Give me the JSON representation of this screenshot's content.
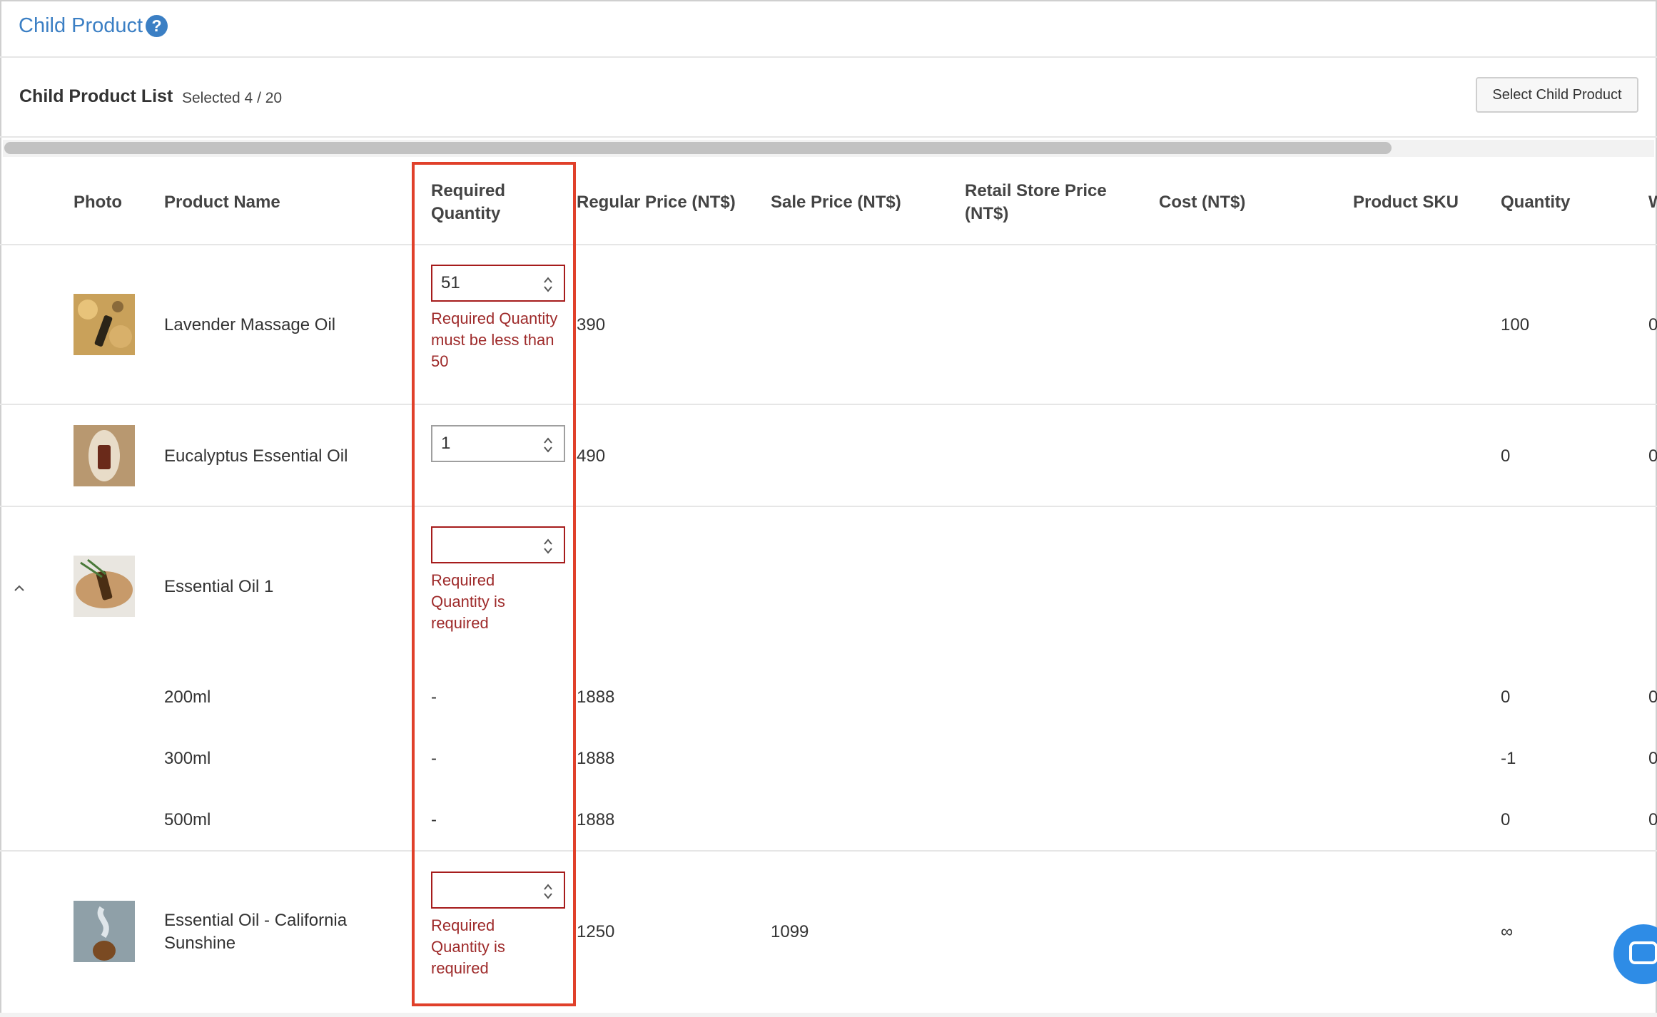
{
  "header": {
    "title": "Child Product",
    "help_icon": "question-circle-icon"
  },
  "list": {
    "title": "Child Product List",
    "selected_text": "Selected 4 / 20",
    "select_button": "Select Child Product"
  },
  "table": {
    "columns": [
      "Photo",
      "Product Name",
      "Required Quantity",
      "Regular Price (NT$)",
      "Sale Price (NT$)",
      "Retail Store Price (NT$)",
      "Cost (NT$)",
      "Product SKU",
      "Quantity",
      "W"
    ],
    "rows": [
      {
        "name": "Lavender Massage Oil",
        "required_quantity": "51",
        "error": "Required Quantity must be less than 50",
        "regular_price": "390",
        "sale_price": "",
        "quantity": "100",
        "extra": "0"
      },
      {
        "name": "Eucalyptus Essential Oil",
        "required_quantity": "1",
        "error": "",
        "regular_price": "490",
        "sale_price": "",
        "quantity": "0",
        "extra": "0"
      },
      {
        "name": "Essential Oil 1",
        "required_quantity": "",
        "error": "Required Quantity is required",
        "regular_price": "",
        "sale_price": "",
        "quantity": "",
        "extra": "",
        "variants": [
          {
            "name": "200ml",
            "required_quantity": "-",
            "regular_price": "1888",
            "quantity": "0",
            "extra": "0"
          },
          {
            "name": "300ml",
            "required_quantity": "-",
            "regular_price": "1888",
            "quantity": "-1",
            "extra": "0"
          },
          {
            "name": "500ml",
            "required_quantity": "-",
            "regular_price": "1888",
            "quantity": "0",
            "extra": "0"
          }
        ]
      },
      {
        "name": "Essential Oil - California Sunshine",
        "required_quantity": "",
        "error": "Required Quantity is required",
        "regular_price": "1250",
        "sale_price": "1099",
        "quantity": "∞",
        "extra": ""
      }
    ]
  },
  "colors": {
    "accent": "#3b7fc4",
    "error": "#9e2a2a",
    "highlight": "#e0402a"
  }
}
